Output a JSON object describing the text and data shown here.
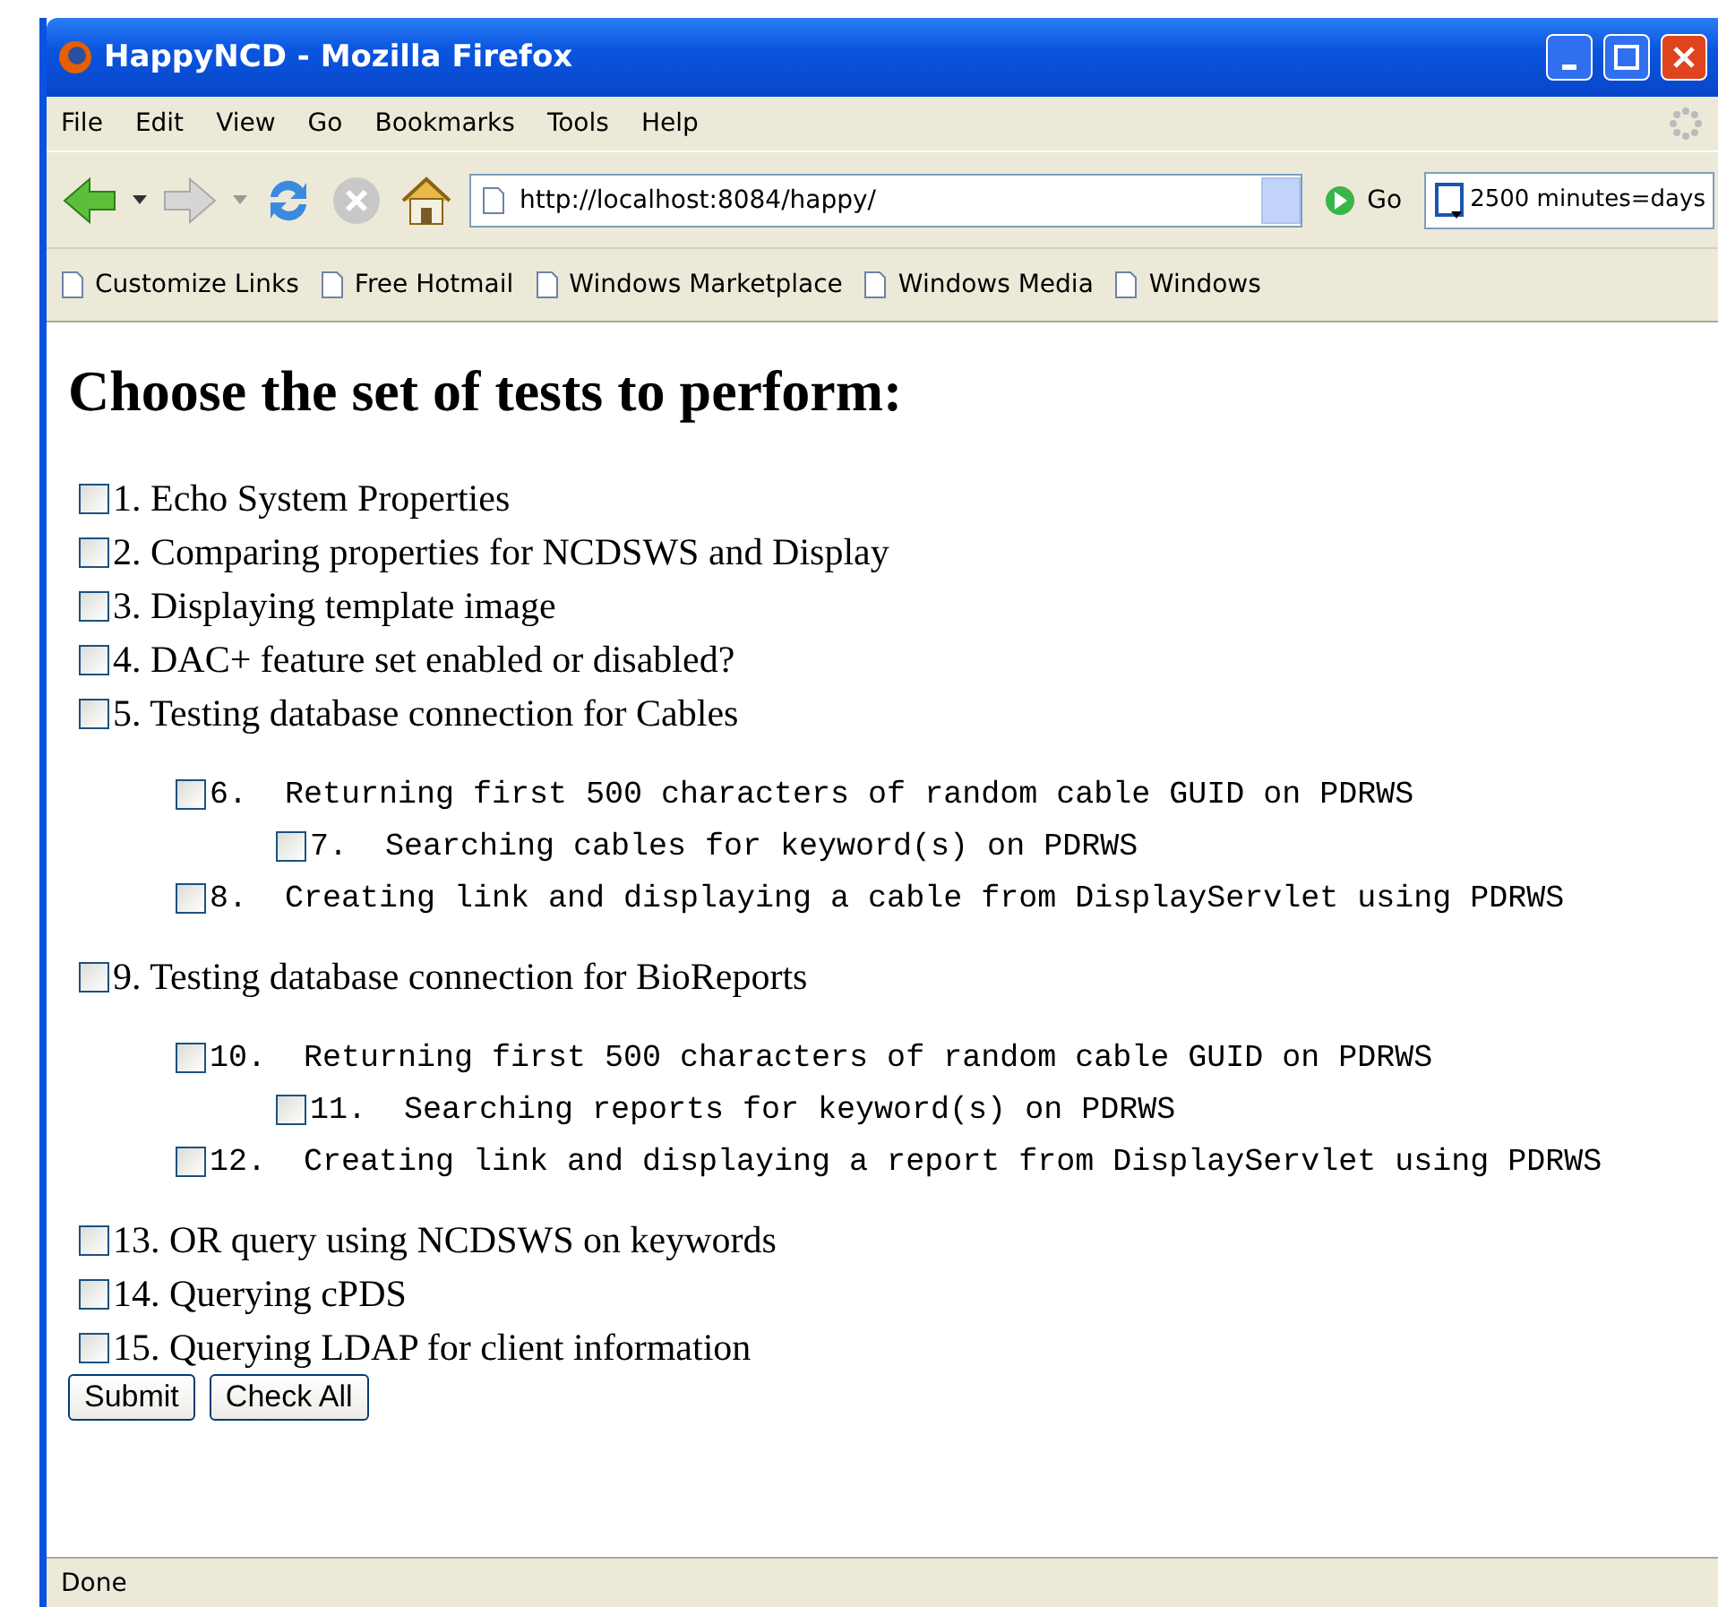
{
  "window": {
    "title": "HappyNCD - Mozilla Firefox"
  },
  "menu": [
    "File",
    "Edit",
    "View",
    "Go",
    "Bookmarks",
    "Tools",
    "Help"
  ],
  "address": {
    "value": "http://localhost:8084/happy/"
  },
  "go_button": "Go",
  "search": {
    "value": "2500 minutes=days"
  },
  "bookmarks": [
    "Customize Links",
    "Free Hotmail",
    "Windows Marketplace",
    "Windows Media",
    "Windows"
  ],
  "heading": "Choose the set of tests to perform:",
  "tests": [
    {
      "kind": "main",
      "label": "1. Echo System Properties",
      "checked": false
    },
    {
      "kind": "main",
      "label": "2. Comparing properties for NCDSWS and Display",
      "checked": false
    },
    {
      "kind": "main",
      "label": "3. Displaying template image",
      "checked": false
    },
    {
      "kind": "main",
      "label": "4. DAC+ feature set enabled or disabled?",
      "checked": false
    },
    {
      "kind": "main",
      "label": "5. Testing database connection for Cables",
      "checked": false,
      "children": [
        {
          "kind": "mono",
          "label": "6.  Returning first 500 characters of random cable GUID on PDRWS",
          "checked": false,
          "children": [
            {
              "kind": "mono",
              "label": "7.  Searching cables for keyword(s) on PDRWS",
              "checked": false
            }
          ]
        },
        {
          "kind": "mono",
          "label": "8.  Creating link and displaying a cable from DisplayServlet using PDRWS",
          "checked": false
        }
      ]
    },
    {
      "kind": "main",
      "label": "9. Testing database connection for BioReports",
      "checked": false,
      "children": [
        {
          "kind": "mono",
          "label": "10.  Returning first 500 characters of random cable GUID on PDRWS",
          "checked": false,
          "children": [
            {
              "kind": "mono",
              "label": "11.  Searching reports for keyword(s) on PDRWS",
              "checked": false
            }
          ]
        },
        {
          "kind": "mono",
          "label": "12.  Creating link and displaying a report from DisplayServlet using PDRWS",
          "checked": false
        }
      ]
    },
    {
      "kind": "main",
      "label": "13. OR query using NCDSWS on keywords",
      "checked": false
    },
    {
      "kind": "main",
      "label": "14. Querying cPDS",
      "checked": false
    },
    {
      "kind": "main",
      "label": "15. Querying LDAP for client information",
      "checked": false
    }
  ],
  "buttons": [
    "Submit",
    "Check All"
  ],
  "status_bar": "Done"
}
